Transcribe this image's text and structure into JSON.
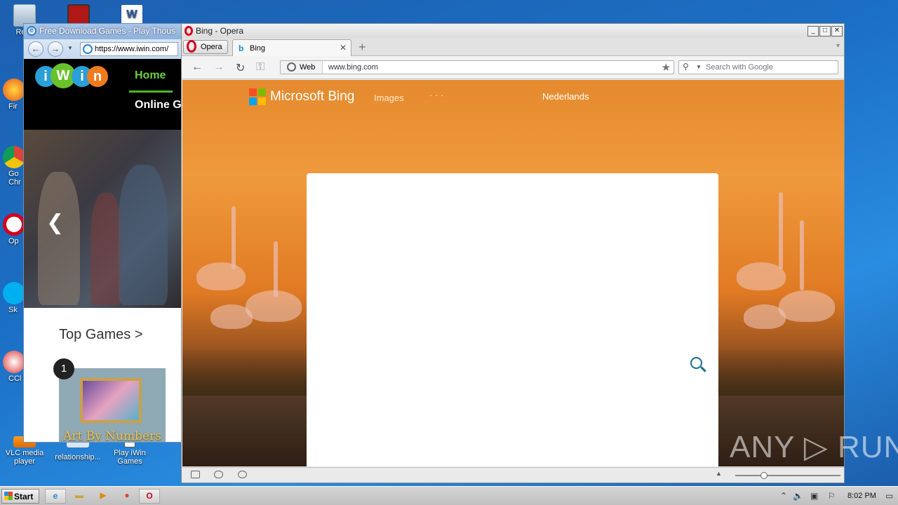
{
  "desktop": {
    "icons": [
      {
        "label": "Recy"
      },
      {
        "label": "Fir"
      },
      {
        "label": "Go\nChr"
      },
      {
        "label": "Op"
      },
      {
        "label": "Sk"
      },
      {
        "label": "CCl"
      },
      {
        "label": "VLC media player"
      },
      {
        "label": "relationship..."
      },
      {
        "label": "Play iWin Games"
      }
    ]
  },
  "ie": {
    "title": "Free Download Games - Play Thous",
    "address": "https://www.iwin.com/",
    "page": {
      "logo_letters": [
        "i",
        "W",
        "i",
        "n"
      ],
      "logo_colors": [
        "#2a9fd8",
        "#6ac22b",
        "#2a9fd8",
        "#f07a1e"
      ],
      "nav_home": "Home",
      "nav_online": "Online G",
      "prev_arrow": "❮",
      "top_games": "Top Games >",
      "rank": "1",
      "game_title": "Art By Numbers"
    }
  },
  "opera": {
    "title": "Bing - Opera",
    "window_buttons": [
      "_",
      "□",
      "✕"
    ],
    "menu_label": "Opera",
    "tab_label": "Bing",
    "tab_icon": "b",
    "tab_close": "✕",
    "new_tab": "+",
    "address_mode": "Web",
    "address": "www.bing.com",
    "search_placeholder": "Search with Google",
    "accent": "#d2001e"
  },
  "bing": {
    "brand": "Microsoft Bing",
    "nav_images": "Images",
    "nav_more": "· · ·",
    "lang_link": "Nederlands",
    "tile_colors": [
      "#f25022",
      "#7fba00",
      "#00a4ef",
      "#ffb900"
    ]
  },
  "watermark": "ANY ▷ RUN",
  "taskbar": {
    "start_label": "Start",
    "clock": "8:02 PM"
  }
}
